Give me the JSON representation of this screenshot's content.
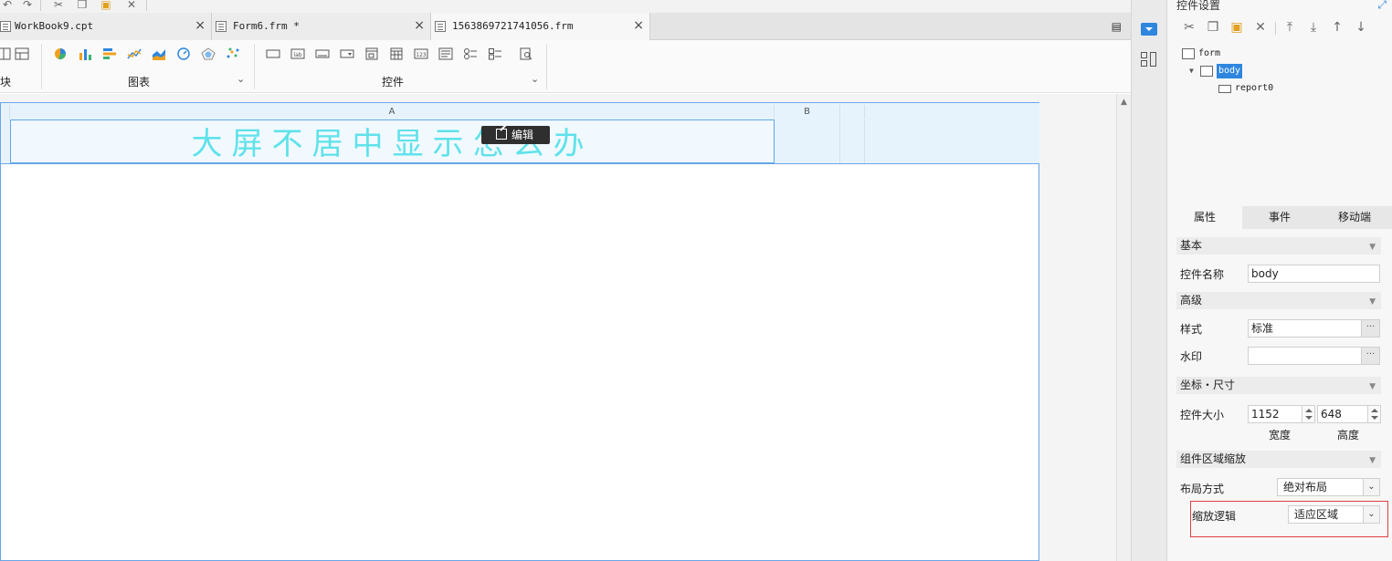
{
  "tabs": [
    {
      "label": "WorkBook9.cpt",
      "close": "×",
      "active": false
    },
    {
      "label": "Form6.frm *",
      "close": "×",
      "active": false
    },
    {
      "label": "1563869721741056.frm",
      "close": "×",
      "active": true
    }
  ],
  "ribbon": {
    "groups": [
      {
        "label": "块"
      },
      {
        "label": "图表",
        "chevron": "⌄"
      },
      {
        "label": "控件",
        "chevron": "⌄"
      }
    ],
    "control_icons": [
      "lab",
      "123"
    ]
  },
  "canvas": {
    "columns": [
      {
        "label": "A"
      },
      {
        "label": "B"
      }
    ],
    "cell_a1_text": "大屏不居中显示怎么办",
    "edit_button_label": "编辑"
  },
  "right_panel": {
    "title": "控件设置",
    "tree": {
      "root": "form",
      "body": "body",
      "child": "report0"
    },
    "prop_tabs": [
      "属性",
      "事件",
      "移动端"
    ],
    "sections": {
      "basic": "基本",
      "advanced": "高级",
      "coords": "坐标・尺寸",
      "zoom": "组件区域缩放"
    },
    "fields": {
      "name_label": "控件名称",
      "name_value": "body",
      "style_label": "样式",
      "style_value": "标准",
      "watermark_label": "水印",
      "watermark_value": "",
      "size_label": "控件大小",
      "width_value": "1152",
      "height_value": "648",
      "width_label": "宽度",
      "height_label": "高度",
      "layout_label": "布局方式",
      "layout_value": "绝对布局",
      "zoom_logic_label": "缩放逻辑",
      "zoom_logic_value": "适应区域",
      "ellipsis": "···"
    }
  },
  "colors": {
    "accent": "#2e86de",
    "cell_text": "#5fe2ea",
    "highlight": "#e04040",
    "frame_border": "#69a6e8"
  }
}
